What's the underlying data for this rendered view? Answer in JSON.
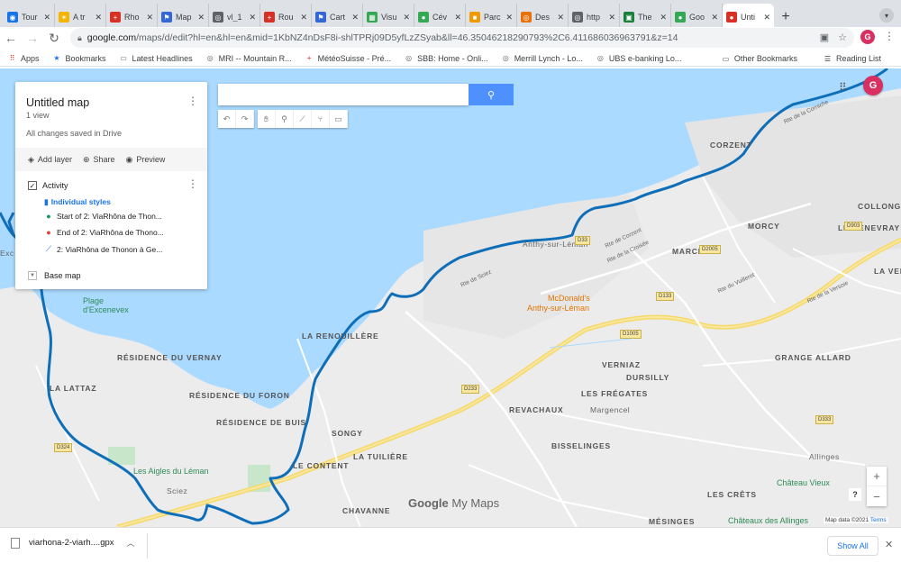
{
  "browser": {
    "tabs": [
      {
        "label": "Tour",
        "color": "#1a73e8",
        "icon": "globe-icon",
        "glyph": "◉"
      },
      {
        "label": "A tr",
        "color": "#f4b400",
        "icon": "sun-icon",
        "glyph": "✶"
      },
      {
        "label": "Rho",
        "color": "#d93025",
        "icon": "swiss-flag-icon",
        "glyph": "+"
      },
      {
        "label": "Map",
        "color": "#3367d6",
        "icon": "flag-icon",
        "glyph": "⚑"
      },
      {
        "label": "vl_1",
        "color": "#5f6368",
        "icon": "globe-icon",
        "glyph": "◎"
      },
      {
        "label": "Rou",
        "color": "#d93025",
        "icon": "swiss-flag-icon",
        "glyph": "+"
      },
      {
        "label": "Cart",
        "color": "#3367d6",
        "icon": "flag-icon",
        "glyph": "⚑"
      },
      {
        "label": "Visu",
        "color": "#34a853",
        "icon": "data-icon",
        "glyph": "▦"
      },
      {
        "label": "Cév",
        "color": "#34a853",
        "icon": "maps-pin-icon",
        "glyph": "●"
      },
      {
        "label": "Parc",
        "color": "#f29900",
        "icon": "square-icon",
        "glyph": "■"
      },
      {
        "label": "Des",
        "color": "#e8710a",
        "icon": "spiral-icon",
        "glyph": "◎"
      },
      {
        "label": "http",
        "color": "#5f6368",
        "icon": "globe-icon",
        "glyph": "◎"
      },
      {
        "label": "The",
        "color": "#188038",
        "icon": "image-icon",
        "glyph": "▣"
      },
      {
        "label": "Goo",
        "color": "#34a853",
        "icon": "maps-pin-icon",
        "glyph": "●"
      },
      {
        "label": "Unti",
        "color": "#d93025",
        "icon": "mymaps-icon",
        "glyph": "●",
        "active": true
      }
    ],
    "close_glyph": "✕",
    "new_tab": "+",
    "url_host": "google.com",
    "url_path": "/maps/d/edit?hl=en&hl=en&mid=1KbNZ4nDsF8i-shlTPRj09D5yfLzZSyab&ll=46.35046218290793%2C6.411686036963791&z=14",
    "profile_initial": "G",
    "bookmarks": [
      {
        "label": "Apps",
        "icon": "apps-icon",
        "glyph": "⠿",
        "color": "#d93025"
      },
      {
        "label": "Bookmarks",
        "icon": "star-icon",
        "glyph": "★",
        "color": "#1a73e8"
      },
      {
        "label": "Latest Headlines",
        "icon": "folder-icon",
        "glyph": "▭",
        "color": "#5f6368"
      },
      {
        "label": "MRI -- Mountain R...",
        "icon": "globe-icon",
        "glyph": "◎",
        "color": "#5f6368"
      },
      {
        "label": "MétéoSuisse - Pré...",
        "icon": "swiss-flag-icon",
        "glyph": "+",
        "color": "#d93025"
      },
      {
        "label": "SBB: Home - Onli...",
        "icon": "globe-icon",
        "glyph": "◎",
        "color": "#5f6368"
      },
      {
        "label": "Merrill Lynch - Lo...",
        "icon": "globe-icon",
        "glyph": "◎",
        "color": "#5f6368"
      },
      {
        "label": "UBS e-banking Lo...",
        "icon": "globe-icon",
        "glyph": "◎",
        "color": "#5f6368"
      }
    ],
    "other_bookmarks": "Other Bookmarks",
    "reading_list": "Reading List"
  },
  "mymaps": {
    "title": "Untitled map",
    "views": "1 view",
    "saved": "All changes saved in Drive",
    "add_layer": "Add layer",
    "share": "Share",
    "preview": "Preview",
    "layer_name": "Activity",
    "styles_link": "Individual styles",
    "features": [
      {
        "label": "Start of 2: ViaRhôna de Thon...",
        "icon": "green-pin-icon",
        "glyph": "●",
        "color": "#0f9d58"
      },
      {
        "label": "End of 2: ViaRhôna de Thono...",
        "icon": "red-pin-icon",
        "glyph": "●",
        "color": "#db4437"
      },
      {
        "label": "2: ViaRhôna de Thonon à Ge...",
        "icon": "route-line-icon",
        "glyph": "⟋",
        "color": "#1a73e8"
      }
    ],
    "base_map": "Base map",
    "brand_google": "Google",
    "brand_mymaps": "My Maps",
    "attribution": "Map data ©2021",
    "terms": "Terms"
  },
  "map_labels": {
    "places": [
      "CORZENT",
      "MORCY",
      "COLLONG",
      "LE GENEVRAY",
      "MARCLAZ",
      "Anthy-sur-Léman",
      "LA VERS",
      "LA RENOUILLÈRE",
      "RÉSIDENCE DU VERNAY",
      "LA LATTAZ",
      "RÉSIDENCE DU FORON",
      "RÉSIDENCE DE BUIS",
      "SONGY",
      "VERNIAZ",
      "DURSILLY",
      "LES FRÉGATES",
      "GRANGE ALLARD",
      "REVACHAUX",
      "Margencel",
      "BISSELINGES",
      "LA TUILIÈRE",
      "LE CONTENT",
      "Sciez",
      "CHAVANNE",
      "LES CRÊTS",
      "Allinges",
      "MÉSINGES",
      "Exc"
    ],
    "pois": [
      "Plage d'Excenevex",
      "Les Aigles du Léman",
      "Château Vieux",
      "Châteaux des Allinges"
    ],
    "food": [
      "McDonald's",
      "Anthy-sur-Léman"
    ],
    "roads": [
      "D33",
      "D2005",
      "D1005",
      "D133",
      "D903",
      "D233",
      "D324",
      "D333",
      "Rte de Corzent",
      "Rte de la Croisée",
      "Rte de Sciez",
      "Rte de la Corniche",
      "Rte du Vuillerot",
      "Rte de la Versoie"
    ]
  },
  "downloads": {
    "file": "viarhona-2-viarh....gpx",
    "show_all": "Show All"
  }
}
